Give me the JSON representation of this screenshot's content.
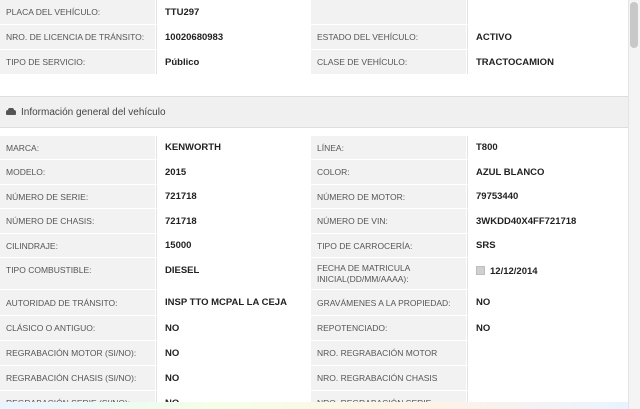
{
  "top_rows": [
    {
      "l1": "PLACA DEL VEHÍCULO:",
      "v1": "TTU297",
      "l2": "",
      "v2": ""
    },
    {
      "l1": "NRO. DE LICENCIA DE TRÁNSITO:",
      "v1": "10020680983",
      "l2": "ESTADO DEL VEHÍCULO:",
      "v2": "ACTIVO"
    },
    {
      "l1": "TIPO DE SERVICIO:",
      "v1": "Público",
      "l2": "CLASE DE VEHÍCULO:",
      "v2": "TRACTOCAMION"
    }
  ],
  "section": {
    "title": "Información general del vehículo",
    "icon": "car-icon"
  },
  "info_rows": [
    {
      "l1": "MARCA:",
      "v1": "KENWORTH",
      "l2": "LÍNEA:",
      "v2": "T800"
    },
    {
      "l1": "MODELO:",
      "v1": "2015",
      "l2": "COLOR:",
      "v2": "AZUL BLANCO"
    },
    {
      "l1": "NÚMERO DE SERIE:",
      "v1": "721718",
      "l2": "NÚMERO DE MOTOR:",
      "v2": "79753440"
    },
    {
      "l1": "NÚMERO DE CHASIS:",
      "v1": "721718",
      "l2": "NÚMERO DE VIN:",
      "v2": "3WKDD40X4FF721718"
    },
    {
      "l1": "CILINDRAJE:",
      "v1": "15000",
      "l2": "TIPO DE CARROCERÍA:",
      "v2": "SRS"
    },
    {
      "l1": "TIPO COMBUSTIBLE:",
      "v1": "DIESEL",
      "l2": "FECHA DE MATRICULA INICIAL(DD/MM/AAAA):",
      "v2": "12/12/2014"
    },
    {
      "l1": "AUTORIDAD DE TRÁNSITO:",
      "v1": "INSP TTO MCPAL LA CEJA",
      "l2": "GRAVÁMENES A LA PROPIEDAD:",
      "v2": "NO"
    },
    {
      "l1": "CLÁSICO O ANTIGUO:",
      "v1": "NO",
      "l2": "REPOTENCIADO:",
      "v2": "NO"
    },
    {
      "l1": "REGRABACIÓN MOTOR (SI/NO):",
      "v1": "NO",
      "l2": "NRO. REGRABACIÓN MOTOR",
      "v2": ""
    },
    {
      "l1": "REGRABACIÓN CHASIS (SI/NO):",
      "v1": "NO",
      "l2": "NRO. REGRABACIÓN CHASIS",
      "v2": ""
    },
    {
      "l1": "REGRABACIÓN SERIE (SI/NO):",
      "v1": "NO",
      "l2": "NRO. REGRABACIÓN SERIE",
      "v2": ""
    }
  ]
}
